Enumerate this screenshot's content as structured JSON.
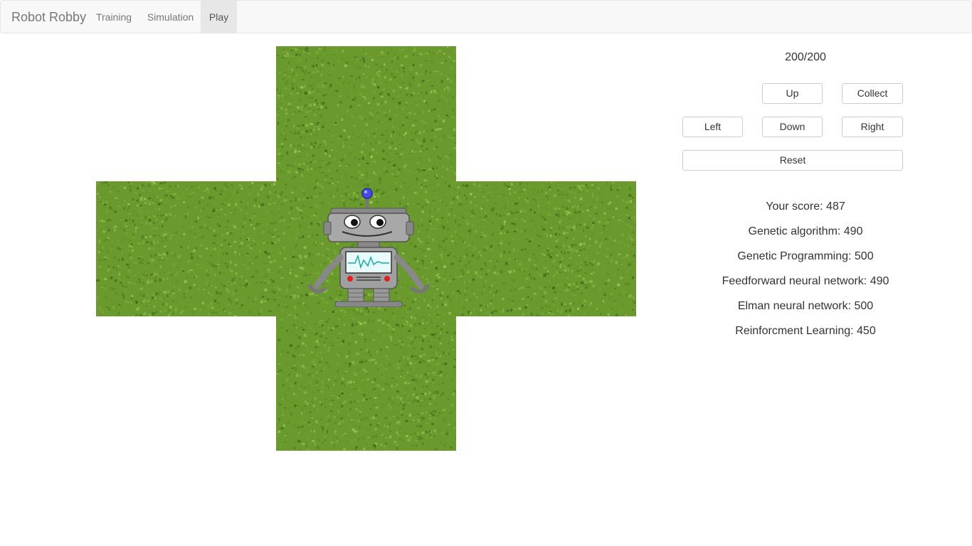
{
  "navbar": {
    "brand": "Robot Robby",
    "items": [
      {
        "label": "Training"
      },
      {
        "label": "Simulation"
      },
      {
        "label": "Play"
      }
    ]
  },
  "status": {
    "steps": "200/200"
  },
  "controls": {
    "up": "Up",
    "collect": "Collect",
    "left": "Left",
    "down": "Down",
    "right": "Right",
    "reset": "Reset"
  },
  "scores": [
    "Your score: 487",
    "Genetic algorithm: 490",
    "Genetic Programming: 500",
    "Feedforward neural network: 490",
    "Elman neural network: 500",
    "Reinforcment Learning: 450"
  ],
  "colors": {
    "grass": "#6a9a2e",
    "grass_light": "#8db844",
    "grass_dark": "#4e7a22"
  }
}
